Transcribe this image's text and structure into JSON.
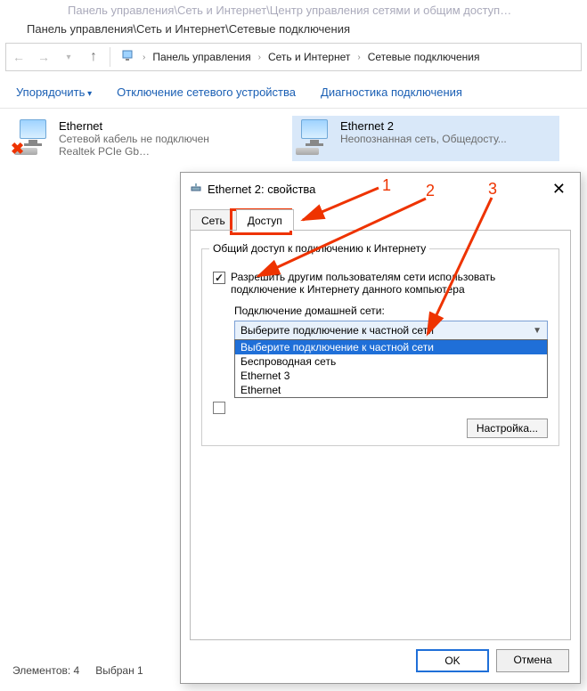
{
  "window": {
    "faded_path": "Панель управления\\Сеть и Интернет\\Центр управления сетями и общим доступ…",
    "title": "Панель управления\\Сеть и Интернет\\Сетевые подключения"
  },
  "breadcrumb": {
    "seg1": "Панель управления",
    "seg2": "Сеть и Интернет",
    "seg3": "Сетевые подключения"
  },
  "toolbar": {
    "organize": "Упорядочить",
    "disable": "Отключение сетевого устройства",
    "diagnose": "Диагностика подключения"
  },
  "connections": [
    {
      "name": "Ethernet",
      "sub": "Сетевой кабель не подключен",
      "device": "Realtek PCIe Gb…"
    },
    {
      "name": "Ethernet 2",
      "sub": "Неопознанная сеть, Общедосту...",
      "device": ""
    }
  ],
  "status": {
    "count_label": "Элементов: 4",
    "selected_label": "Выбран 1"
  },
  "dialog": {
    "title": "Ethernet 2: свойства",
    "close": "✕",
    "tabs": {
      "network": "Сеть",
      "sharing": "Доступ"
    },
    "group_title": "Общий доступ к подключению к Интернету",
    "chk_allow": "Разрешить другим пользователям сети использовать подключение к Интернету данного компьютера",
    "home_label": "Подключение домашней сети:",
    "combo_value": "Выберите подключение к частной сети",
    "dropdown": [
      "Выберите подключение к частной сети",
      "Беспроводная сеть",
      "Ethernet 3",
      "Ethernet"
    ],
    "chk_manage_prefix": "",
    "settings_btn": "Настройка...",
    "ok": "OK",
    "cancel": "Отмена"
  },
  "annotations": {
    "n1": "1",
    "n2": "2",
    "n3": "3"
  }
}
